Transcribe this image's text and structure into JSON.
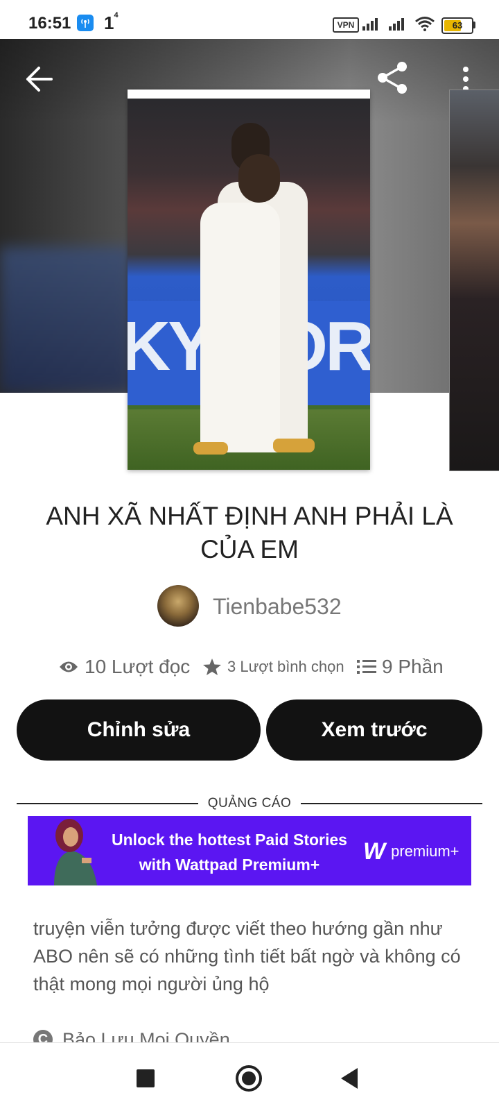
{
  "status_bar": {
    "time": "16:51",
    "notification_count": "1",
    "notification_sup": "4",
    "vpn_label": "VPN",
    "battery_level": "63"
  },
  "toolbar": {
    "back_icon": "arrow-left-icon",
    "share_icon": "share-icon",
    "more_icon": "more-vertical-icon"
  },
  "story": {
    "title": "ANH XÃ NHẤT ĐỊNH ANH PHẢI LÀ CỦA EM",
    "author": "Tienbabe532",
    "stats": {
      "reads": "10 Lượt đọc",
      "votes": "3 Lượt bình chọn",
      "parts": "9 Phần"
    },
    "description": "truyện viễn tưởng được viết theo hướng gần như ABO nên sẽ có những tình tiết bất ngờ  và không có thật mong mọi người ủng hộ",
    "copyright": "Bảo Lưu Mọi Quyền"
  },
  "actions": {
    "edit_label": "Chỉnh sửa",
    "preview_label": "Xem trước"
  },
  "ad": {
    "label": "QUẢNG CÁO",
    "line1": "Unlock the hottest Paid Stories",
    "line2": "with Wattpad Premium+",
    "brand": "premium+",
    "brand_mark": "W",
    "cover_text": "KYWORTH",
    "bg_color": "#5b16f2"
  },
  "nav": {
    "recents": "square-icon",
    "home": "circle-icon",
    "back": "triangle-back-icon"
  }
}
